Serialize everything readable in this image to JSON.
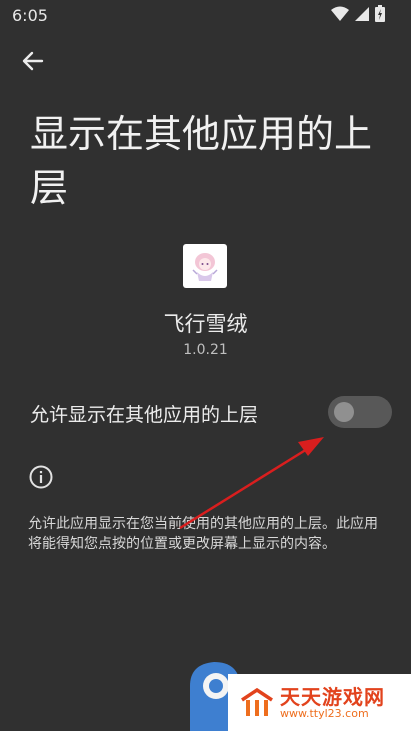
{
  "status_bar": {
    "time": "6:05"
  },
  "page": {
    "title": "显示在其他应用的上层"
  },
  "app": {
    "name": "飞行雪绒",
    "version": "1.0.21"
  },
  "setting": {
    "label": "允许显示在其他应用的上层",
    "enabled": false
  },
  "info": {
    "description": "允许此应用显示在您当前使用的其他应用的上层。此应用将能得知您点按的位置或更改屏幕上显示的内容。"
  },
  "watermark": {
    "title": "天天游戏网",
    "url": "www.ttyl23.com"
  },
  "colors": {
    "background": "#303030",
    "switch_track": "#585858",
    "switch_knob": "#909090",
    "annotation_arrow": "#d91e1e",
    "watermark_accent": "#e2431d"
  }
}
